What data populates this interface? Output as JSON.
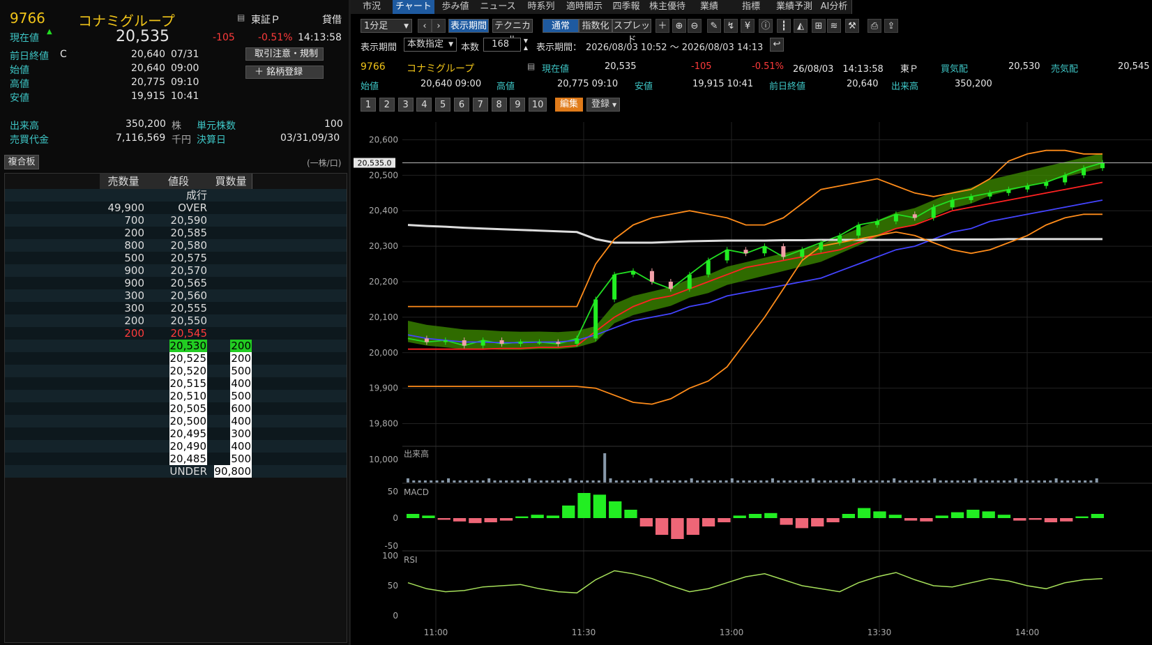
{
  "stock": {
    "code": "9766",
    "name": "コナミグループ",
    "market": "東証Ｐ",
    "lending": "貸借",
    "current_label": "現在値",
    "current_price": "20,535",
    "change": "-105",
    "change_pct": "-0.51%",
    "time": "14:13:58",
    "prev_close_label": "前日終値",
    "prev_close_flag": "C",
    "prev_close": "20,640",
    "prev_close_date": "07/31",
    "open_label": "始値",
    "open": "20,640",
    "open_time": "09:00",
    "high_label": "高値",
    "high": "20,775",
    "high_time": "09:10",
    "low_label": "安値",
    "low": "19,915",
    "low_time": "10:41",
    "volume_label": "出来高",
    "volume": "350,200",
    "volume_unit": "株",
    "unit_label": "単元株数",
    "unit": "100",
    "turnover_label": "売買代金",
    "turnover": "7,116,569",
    "turnover_unit": "千円",
    "settle_label": "決算日",
    "settle": "03/31,09/30",
    "btn_notice": "取引注意・規制",
    "btn_register": "銘柄登録"
  },
  "board": {
    "title": "複合板",
    "unit_note": "(一株/口)",
    "headers": [
      "売数量",
      "値段",
      "買数量"
    ],
    "rows": [
      {
        "sell": "",
        "price": "成行",
        "buy": "",
        "style": "normal"
      },
      {
        "sell": "49,900",
        "price": "OVER",
        "buy": "",
        "style": "normal"
      },
      {
        "sell": "700",
        "price": "20,590",
        "buy": "",
        "style": "normal"
      },
      {
        "sell": "200",
        "price": "20,585",
        "buy": "",
        "style": "normal"
      },
      {
        "sell": "800",
        "price": "20,580",
        "buy": "",
        "style": "normal"
      },
      {
        "sell": "500",
        "price": "20,575",
        "buy": "",
        "style": "normal"
      },
      {
        "sell": "900",
        "price": "20,570",
        "buy": "",
        "style": "normal"
      },
      {
        "sell": "900",
        "price": "20,565",
        "buy": "",
        "style": "normal"
      },
      {
        "sell": "300",
        "price": "20,560",
        "buy": "",
        "style": "normal"
      },
      {
        "sell": "300",
        "price": "20,555",
        "buy": "",
        "style": "normal"
      },
      {
        "sell": "200",
        "price": "20,550",
        "buy": "",
        "style": "normal"
      },
      {
        "sell": "200",
        "price": "20,545",
        "buy": "",
        "style": "red"
      },
      {
        "sell": "",
        "price": "20,530",
        "buy": "200",
        "style": "green"
      },
      {
        "sell": "",
        "price": "20,525",
        "buy": "200",
        "style": "box"
      },
      {
        "sell": "",
        "price": "20,520",
        "buy": "500",
        "style": "box"
      },
      {
        "sell": "",
        "price": "20,515",
        "buy": "400",
        "style": "box"
      },
      {
        "sell": "",
        "price": "20,510",
        "buy": "500",
        "style": "box"
      },
      {
        "sell": "",
        "price": "20,505",
        "buy": "600",
        "style": "box"
      },
      {
        "sell": "",
        "price": "20,500",
        "buy": "400",
        "style": "box"
      },
      {
        "sell": "",
        "price": "20,495",
        "buy": "300",
        "style": "box"
      },
      {
        "sell": "",
        "price": "20,490",
        "buy": "400",
        "style": "box"
      },
      {
        "sell": "",
        "price": "20,485",
        "buy": "500",
        "style": "box"
      },
      {
        "sell": "",
        "price": "UNDER",
        "buy": "90,800",
        "style": "box"
      }
    ]
  },
  "tabs": [
    "市況",
    "チャート",
    "歩み値",
    "ニュース",
    "時系列",
    "適時開示",
    "四季報",
    "株主優待",
    "業績",
    "指標",
    "業績予測",
    "AI分析"
  ],
  "active_tab": "チャート",
  "toolbar": {
    "interval": "1分足",
    "period_btn": "表示期間",
    "tech_btn": "テクニカル",
    "normal_btn": "通常",
    "index_btn": "指数化",
    "spread_btn": "スプレッド",
    "period_label": "表示期間",
    "period_mode": "本数指定",
    "count_label": "本数",
    "count": "168",
    "range_label": "表示期間：",
    "range": "2026/08/03 10:52 ～ 2026/08/03 14:13",
    "edit_btn": "編集",
    "register_btn": "登録",
    "num_buttons": [
      "1",
      "2",
      "3",
      "4",
      "5",
      "6",
      "7",
      "8",
      "9",
      "10"
    ]
  },
  "quote_bar": {
    "code": "9766",
    "name": "コナミグループ",
    "current_label": "現在値",
    "current": "20,535",
    "change": "-105",
    "change_pct": "-0.51%",
    "datetime": "26/08/03　14:13:58",
    "market": "東Ｐ",
    "bid_label": "買気配",
    "bid": "20,530",
    "ask_label": "売気配",
    "ask": "20,545",
    "open_label": "始値",
    "open": "20,640  09:00",
    "high_label": "高値",
    "high": "20,775  09:10",
    "low_label": "安値",
    "low": "19,915  10:41",
    "prev_label": "前日終値",
    "prev": "20,640",
    "vol_label": "出来高",
    "vol": "350,200"
  },
  "chart_data": [
    {
      "type": "line",
      "title": "",
      "ylim": [
        19750,
        20650
      ],
      "y_ticks": [
        "20,600",
        "20,500",
        "20,400",
        "20,300",
        "20,200",
        "20,100",
        "20,000",
        "19,900",
        "19,800"
      ],
      "y_tick_values": [
        20600,
        20500,
        20400,
        20300,
        20200,
        20100,
        20000,
        19900,
        19800
      ],
      "x_ticks": [
        "11:00",
        "11:30",
        "13:00",
        "13:30",
        "14:00"
      ],
      "current_price_label": "20,535.0",
      "current_price": 20535,
      "series": [
        {
          "values": [
            20040,
            20030,
            20035,
            20020,
            20035,
            20025,
            20030,
            20030,
            20025,
            20040,
            20150,
            20220,
            20230,
            20200,
            20180,
            20220,
            20260,
            20290,
            20280,
            20300,
            20270,
            20290,
            20310,
            20330,
            20360,
            20370,
            20390,
            20380,
            20410,
            20430,
            20440,
            20450,
            20460,
            20470,
            20480,
            20500,
            20520,
            20535
          ],
          "color": "#22dd22"
        },
        {
          "values": [
            20010,
            20010,
            20010,
            20010,
            20010,
            20012,
            20012,
            20015,
            20015,
            20020,
            20060,
            20100,
            20130,
            20150,
            20160,
            20180,
            20200,
            20220,
            20240,
            20250,
            20260,
            20270,
            20280,
            20290,
            20310,
            20330,
            20350,
            20360,
            20380,
            20400,
            20410,
            20420,
            20430,
            20440,
            20450,
            20460,
            20470,
            20480
          ],
          "color": "#ff2222"
        },
        {
          "values": [
            20050,
            20040,
            20035,
            20030,
            20030,
            20028,
            20028,
            20030,
            20030,
            20035,
            20050,
            20070,
            20090,
            20100,
            20110,
            20130,
            20140,
            20160,
            20170,
            20180,
            20190,
            20200,
            20210,
            20230,
            20250,
            20270,
            20290,
            20300,
            20320,
            20340,
            20350,
            20370,
            20380,
            20390,
            20400,
            20410,
            20420,
            20430
          ],
          "color": "#4444ff"
        },
        {
          "values": [
            20360,
            20357,
            20355,
            20352,
            20350,
            20348,
            20346,
            20344,
            20342,
            20340,
            20320,
            20310,
            20310,
            20310,
            20312,
            20314,
            20315,
            20316,
            20316,
            20316,
            20317,
            20317,
            20318,
            20318,
            20318,
            20318,
            20318,
            20318,
            20318,
            20319,
            20319,
            20319,
            20320,
            20320,
            20320,
            20320,
            20320,
            20320
          ],
          "color": "#dddddd"
        },
        {
          "values": [
            19905,
            19905,
            19905,
            19905,
            19905,
            19905,
            19905,
            19905,
            19905,
            19905,
            19900,
            19880,
            19860,
            19855,
            19870,
            19900,
            19920,
            19960,
            20030,
            20100,
            20180,
            20260,
            20300,
            20310,
            20320,
            20330,
            20340,
            20330,
            20310,
            20290,
            20280,
            20290,
            20310,
            20330,
            20360,
            20380,
            20390,
            20390
          ],
          "color": "#ff8c1a"
        },
        {
          "values": [
            20130,
            20130,
            20130,
            20130,
            20130,
            20130,
            20130,
            20130,
            20130,
            20130,
            20250,
            20320,
            20360,
            20380,
            20390,
            20400,
            20390,
            20380,
            20360,
            20360,
            20380,
            20420,
            20460,
            20470,
            20480,
            20490,
            20470,
            20450,
            20440,
            20450,
            20460,
            20490,
            20540,
            20560,
            20570,
            20570,
            20560,
            20560
          ],
          "color": "#ff8c1a"
        }
      ]
    },
    {
      "type": "bar",
      "label": "出来高",
      "y_ticks": [
        "10,000"
      ]
    },
    {
      "type": "bar",
      "label": "MACD",
      "y_ticks": [
        "50",
        "0",
        "-50"
      ],
      "values": [
        5,
        3,
        -2,
        -4,
        -6,
        -5,
        -3,
        2,
        4,
        3,
        15,
        30,
        28,
        20,
        10,
        -10,
        -20,
        -25,
        -20,
        -10,
        -5,
        3,
        5,
        6,
        -8,
        -12,
        -10,
        -5,
        5,
        12,
        8,
        4,
        -3,
        -4,
        3,
        7,
        10,
        8,
        4,
        -3,
        -2,
        -5,
        -4,
        2,
        5
      ]
    },
    {
      "type": "line",
      "label": "RSI",
      "y_ticks": [
        "100",
        "50",
        "0"
      ],
      "ylim": [
        0,
        100
      ],
      "values": [
        55,
        45,
        40,
        42,
        48,
        50,
        52,
        45,
        40,
        38,
        60,
        75,
        70,
        62,
        50,
        40,
        45,
        55,
        65,
        70,
        60,
        50,
        45,
        40,
        55,
        65,
        72,
        60,
        50,
        48,
        55,
        62,
        58,
        50,
        45,
        55,
        60,
        62
      ]
    }
  ],
  "colors": {
    "accent": "#1e5aa0",
    "up": "#22dd22",
    "down": "#ff3b3b",
    "label": "#3ec6c6",
    "code": "#f0c419"
  }
}
